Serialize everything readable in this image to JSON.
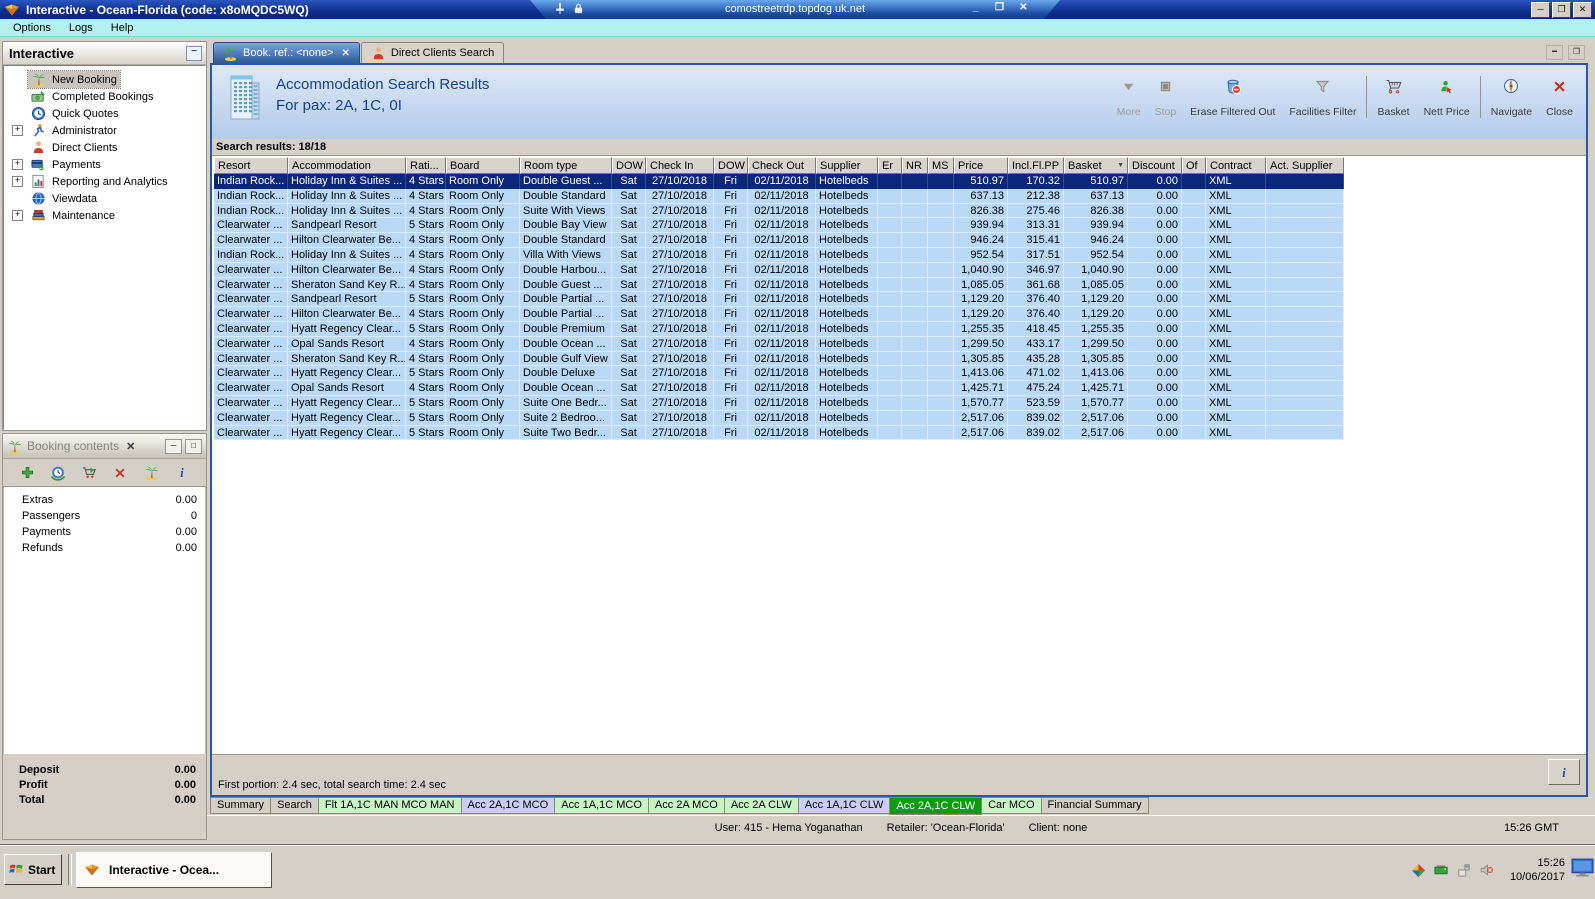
{
  "window": {
    "title": "Interactive - Ocean-Florida (code: x8oMQDC5WQ)"
  },
  "rdp": {
    "host": "comostreetrdp.topdog.uk.net"
  },
  "menu": {
    "items": [
      "Options",
      "Logs",
      "Help"
    ]
  },
  "sidebar": {
    "title": "Interactive",
    "items": [
      {
        "label": "New Booking",
        "icon": "palm-tree-icon",
        "expandable": false,
        "selected": true
      },
      {
        "label": "Completed Bookings",
        "icon": "money-icon",
        "expandable": false
      },
      {
        "label": "Quick Quotes",
        "icon": "clock-icon",
        "expandable": false
      },
      {
        "label": "Administrator",
        "icon": "runner-icon",
        "expandable": true
      },
      {
        "label": "Direct Clients",
        "icon": "person-icon",
        "expandable": false
      },
      {
        "label": "Payments",
        "icon": "payments-icon",
        "expandable": true
      },
      {
        "label": "Reporting and Analytics",
        "icon": "report-icon",
        "expandable": true
      },
      {
        "label": "Viewdata",
        "icon": "globe-icon",
        "expandable": false
      },
      {
        "label": "Maintenance",
        "icon": "books-icon",
        "expandable": true
      }
    ]
  },
  "booking_contents": {
    "title": "Booking contents",
    "toolbar": [
      {
        "name": "add-button",
        "icon": "plus-icon"
      },
      {
        "name": "quote-button",
        "icon": "quote-clock-icon"
      },
      {
        "name": "move-to-basket-button",
        "icon": "cart-icon"
      },
      {
        "name": "delete-button",
        "icon": "red-x-icon"
      },
      {
        "name": "holiday-button",
        "icon": "palm-tree-icon"
      },
      {
        "name": "info-button",
        "icon": "info-icon"
      }
    ],
    "rows": [
      {
        "label": "Extras",
        "value": "0.00"
      },
      {
        "label": "Passengers",
        "value": "0"
      },
      {
        "label": "Payments",
        "value": "0.00"
      },
      {
        "label": "Refunds",
        "value": "0.00"
      }
    ],
    "totals": [
      {
        "label": "Deposit",
        "value": "0.00"
      },
      {
        "label": "Profit",
        "value": "0.00"
      },
      {
        "label": "Total",
        "value": "0.00"
      }
    ]
  },
  "tabs": [
    {
      "label": "Book. ref.: <none>",
      "icon": "palm-tree-icon",
      "active": true,
      "closable": true
    },
    {
      "label": "Direct Clients Search",
      "icon": "person-icon",
      "active": false,
      "closable": false
    }
  ],
  "header": {
    "title": "Accommodation Search Results",
    "subtitle": "For pax: 2A, 1C, 0I",
    "toolbar": [
      {
        "label": "More",
        "icon": "more-icon",
        "disabled": true,
        "group_end": false
      },
      {
        "label": "Stop",
        "icon": "stop-icon",
        "disabled": true,
        "group_end": false
      },
      {
        "label": "Erase Filtered Out",
        "icon": "erase-icon",
        "disabled": false,
        "group_end": false
      },
      {
        "label": "Facilities Filter",
        "icon": "filter-icon",
        "disabled": false,
        "group_end": true
      },
      {
        "label": "Basket",
        "icon": "basket-icon",
        "disabled": false,
        "group_end": false
      },
      {
        "label": "Nett Price",
        "icon": "nett-price-icon",
        "disabled": false,
        "group_end": true
      },
      {
        "label": "Navigate",
        "icon": "navigate-icon",
        "disabled": false,
        "group_end": false
      },
      {
        "label": "Close",
        "icon": "close-red-icon",
        "disabled": false,
        "group_end": false
      }
    ]
  },
  "results": {
    "count_label": "Search results: 18/18",
    "columns": [
      "Resort",
      "Accommodation",
      "Rati...",
      "Board",
      "Room type",
      "DOW",
      "Check In",
      "DOW",
      "Check Out",
      "Supplier",
      "Er",
      "NR",
      "MS",
      "Price",
      "Incl.Fl.PP",
      "Basket",
      "Discount",
      "Of",
      "Contract",
      "Act. Supplier"
    ],
    "sorted_column": "Basket",
    "selected_row": 0,
    "rows": [
      [
        "Indian Rock...",
        "Holiday Inn & Suites ...",
        "4 Stars",
        "Room Only",
        "Double Guest ...",
        "Sat",
        "27/10/2018",
        "Fri",
        "02/11/2018",
        "Hotelbeds",
        "",
        "",
        "",
        "510.97",
        "170.32",
        "510.97",
        "0.00",
        "",
        "XML",
        ""
      ],
      [
        "Indian Rock...",
        "Holiday Inn & Suites ...",
        "4 Stars",
        "Room Only",
        "Double Standard",
        "Sat",
        "27/10/2018",
        "Fri",
        "02/11/2018",
        "Hotelbeds",
        "",
        "",
        "",
        "637.13",
        "212.38",
        "637.13",
        "0.00",
        "",
        "XML",
        ""
      ],
      [
        "Indian Rock...",
        "Holiday Inn & Suites ...",
        "4 Stars",
        "Room Only",
        "Suite With Views",
        "Sat",
        "27/10/2018",
        "Fri",
        "02/11/2018",
        "Hotelbeds",
        "",
        "",
        "",
        "826.38",
        "275.46",
        "826.38",
        "0.00",
        "",
        "XML",
        ""
      ],
      [
        "Clearwater ...",
        "Sandpearl Resort",
        "5 Stars",
        "Room Only",
        "Double Bay View",
        "Sat",
        "27/10/2018",
        "Fri",
        "02/11/2018",
        "Hotelbeds",
        "",
        "",
        "",
        "939.94",
        "313.31",
        "939.94",
        "0.00",
        "",
        "XML",
        ""
      ],
      [
        "Clearwater ...",
        "Hilton Clearwater Be...",
        "4 Stars",
        "Room Only",
        "Double Standard",
        "Sat",
        "27/10/2018",
        "Fri",
        "02/11/2018",
        "Hotelbeds",
        "",
        "",
        "",
        "946.24",
        "315.41",
        "946.24",
        "0.00",
        "",
        "XML",
        ""
      ],
      [
        "Indian Rock...",
        "Holiday Inn & Suites ...",
        "4 Stars",
        "Room Only",
        "Villa With Views",
        "Sat",
        "27/10/2018",
        "Fri",
        "02/11/2018",
        "Hotelbeds",
        "",
        "",
        "",
        "952.54",
        "317.51",
        "952.54",
        "0.00",
        "",
        "XML",
        ""
      ],
      [
        "Clearwater ...",
        "Hilton Clearwater Be...",
        "4 Stars",
        "Room Only",
        "Double Harbou...",
        "Sat",
        "27/10/2018",
        "Fri",
        "02/11/2018",
        "Hotelbeds",
        "",
        "",
        "",
        "1,040.90",
        "346.97",
        "1,040.90",
        "0.00",
        "",
        "XML",
        ""
      ],
      [
        "Clearwater ...",
        "Sheraton Sand Key R...",
        "4 Stars",
        "Room Only",
        "Double Guest ...",
        "Sat",
        "27/10/2018",
        "Fri",
        "02/11/2018",
        "Hotelbeds",
        "",
        "",
        "",
        "1,085.05",
        "361.68",
        "1,085.05",
        "0.00",
        "",
        "XML",
        ""
      ],
      [
        "Clearwater ...",
        "Sandpearl Resort",
        "5 Stars",
        "Room Only",
        "Double Partial ...",
        "Sat",
        "27/10/2018",
        "Fri",
        "02/11/2018",
        "Hotelbeds",
        "",
        "",
        "",
        "1,129.20",
        "376.40",
        "1,129.20",
        "0.00",
        "",
        "XML",
        ""
      ],
      [
        "Clearwater ...",
        "Hilton Clearwater Be...",
        "4 Stars",
        "Room Only",
        "Double Partial ...",
        "Sat",
        "27/10/2018",
        "Fri",
        "02/11/2018",
        "Hotelbeds",
        "",
        "",
        "",
        "1,129.20",
        "376.40",
        "1,129.20",
        "0.00",
        "",
        "XML",
        ""
      ],
      [
        "Clearwater ...",
        "Hyatt Regency Clear...",
        "5 Stars",
        "Room Only",
        "Double Premium",
        "Sat",
        "27/10/2018",
        "Fri",
        "02/11/2018",
        "Hotelbeds",
        "",
        "",
        "",
        "1,255.35",
        "418.45",
        "1,255.35",
        "0.00",
        "",
        "XML",
        ""
      ],
      [
        "Clearwater ...",
        "Opal Sands Resort",
        "4 Stars",
        "Room Only",
        "Double Ocean ...",
        "Sat",
        "27/10/2018",
        "Fri",
        "02/11/2018",
        "Hotelbeds",
        "",
        "",
        "",
        "1,299.50",
        "433.17",
        "1,299.50",
        "0.00",
        "",
        "XML",
        ""
      ],
      [
        "Clearwater ...",
        "Sheraton Sand Key R...",
        "4 Stars",
        "Room Only",
        "Double Gulf View",
        "Sat",
        "27/10/2018",
        "Fri",
        "02/11/2018",
        "Hotelbeds",
        "",
        "",
        "",
        "1,305.85",
        "435.28",
        "1,305.85",
        "0.00",
        "",
        "XML",
        ""
      ],
      [
        "Clearwater ...",
        "Hyatt Regency Clear...",
        "5 Stars",
        "Room Only",
        "Double Deluxe",
        "Sat",
        "27/10/2018",
        "Fri",
        "02/11/2018",
        "Hotelbeds",
        "",
        "",
        "",
        "1,413.06",
        "471.02",
        "1,413.06",
        "0.00",
        "",
        "XML",
        ""
      ],
      [
        "Clearwater ...",
        "Opal Sands Resort",
        "4 Stars",
        "Room Only",
        "Double Ocean ...",
        "Sat",
        "27/10/2018",
        "Fri",
        "02/11/2018",
        "Hotelbeds",
        "",
        "",
        "",
        "1,425.71",
        "475.24",
        "1,425.71",
        "0.00",
        "",
        "XML",
        ""
      ],
      [
        "Clearwater ...",
        "Hyatt Regency Clear...",
        "5 Stars",
        "Room Only",
        "Suite One Bedr...",
        "Sat",
        "27/10/2018",
        "Fri",
        "02/11/2018",
        "Hotelbeds",
        "",
        "",
        "",
        "1,570.77",
        "523.59",
        "1,570.77",
        "0.00",
        "",
        "XML",
        ""
      ],
      [
        "Clearwater ...",
        "Hyatt Regency Clear...",
        "5 Stars",
        "Room Only",
        "Suite 2 Bedroo...",
        "Sat",
        "27/10/2018",
        "Fri",
        "02/11/2018",
        "Hotelbeds",
        "",
        "",
        "",
        "2,517.06",
        "839.02",
        "2,517.06",
        "0.00",
        "",
        "XML",
        ""
      ],
      [
        "Clearwater ...",
        "Hyatt Regency Clear...",
        "5 Stars",
        "Room Only",
        "Suite Two Bedr...",
        "Sat",
        "27/10/2018",
        "Fri",
        "02/11/2018",
        "Hotelbeds",
        "",
        "",
        "",
        "2,517.06",
        "839.02",
        "2,517.06",
        "0.00",
        "",
        "XML",
        ""
      ]
    ],
    "footer": "First portion: 2.4 sec, total search time: 2.4 sec"
  },
  "bottom_tabs": [
    {
      "label": "Summary",
      "color": "grey",
      "active": false
    },
    {
      "label": "Search",
      "color": "grey",
      "active": false
    },
    {
      "label": "Flt 1A,1C MAN MCO MAN",
      "color": "green",
      "active": false
    },
    {
      "label": "Acc 2A,1C MCO",
      "color": "lavender",
      "active": false
    },
    {
      "label": "Acc 1A,1C MCO",
      "color": "green",
      "active": false
    },
    {
      "label": "Acc 2A MCO",
      "color": "green",
      "active": false
    },
    {
      "label": "Acc 2A CLW",
      "color": "green",
      "active": false
    },
    {
      "label": "Acc 1A,1C CLW",
      "color": "lavender",
      "active": false
    },
    {
      "label": "Acc 2A,1C CLW",
      "color": "active-green",
      "active": true
    },
    {
      "label": "Car MCO",
      "color": "green",
      "active": false
    },
    {
      "label": "Financial Summary",
      "color": "grey",
      "active": false
    }
  ],
  "status_bar": {
    "user": "User: 415 - Hema Yoganathan",
    "retailer": "Retailer: 'Ocean-Florida'",
    "client": "Client: none",
    "time": "15:26 GMT"
  },
  "taskbar": {
    "start": "Start",
    "task": "Interactive - Ocea...",
    "time": "15:26",
    "date": "10/06/2017"
  },
  "colors": {
    "selected_row": "#0a2878",
    "row_blue": "#b9d9f7",
    "active_tab_green": "#0b9e0b",
    "pale_green_tab": "#c9f3c5",
    "lavender_tab": "#ccccf4",
    "menu_cyan": "#b2f2ee",
    "titlebar_navy": "#0d2e8c"
  }
}
